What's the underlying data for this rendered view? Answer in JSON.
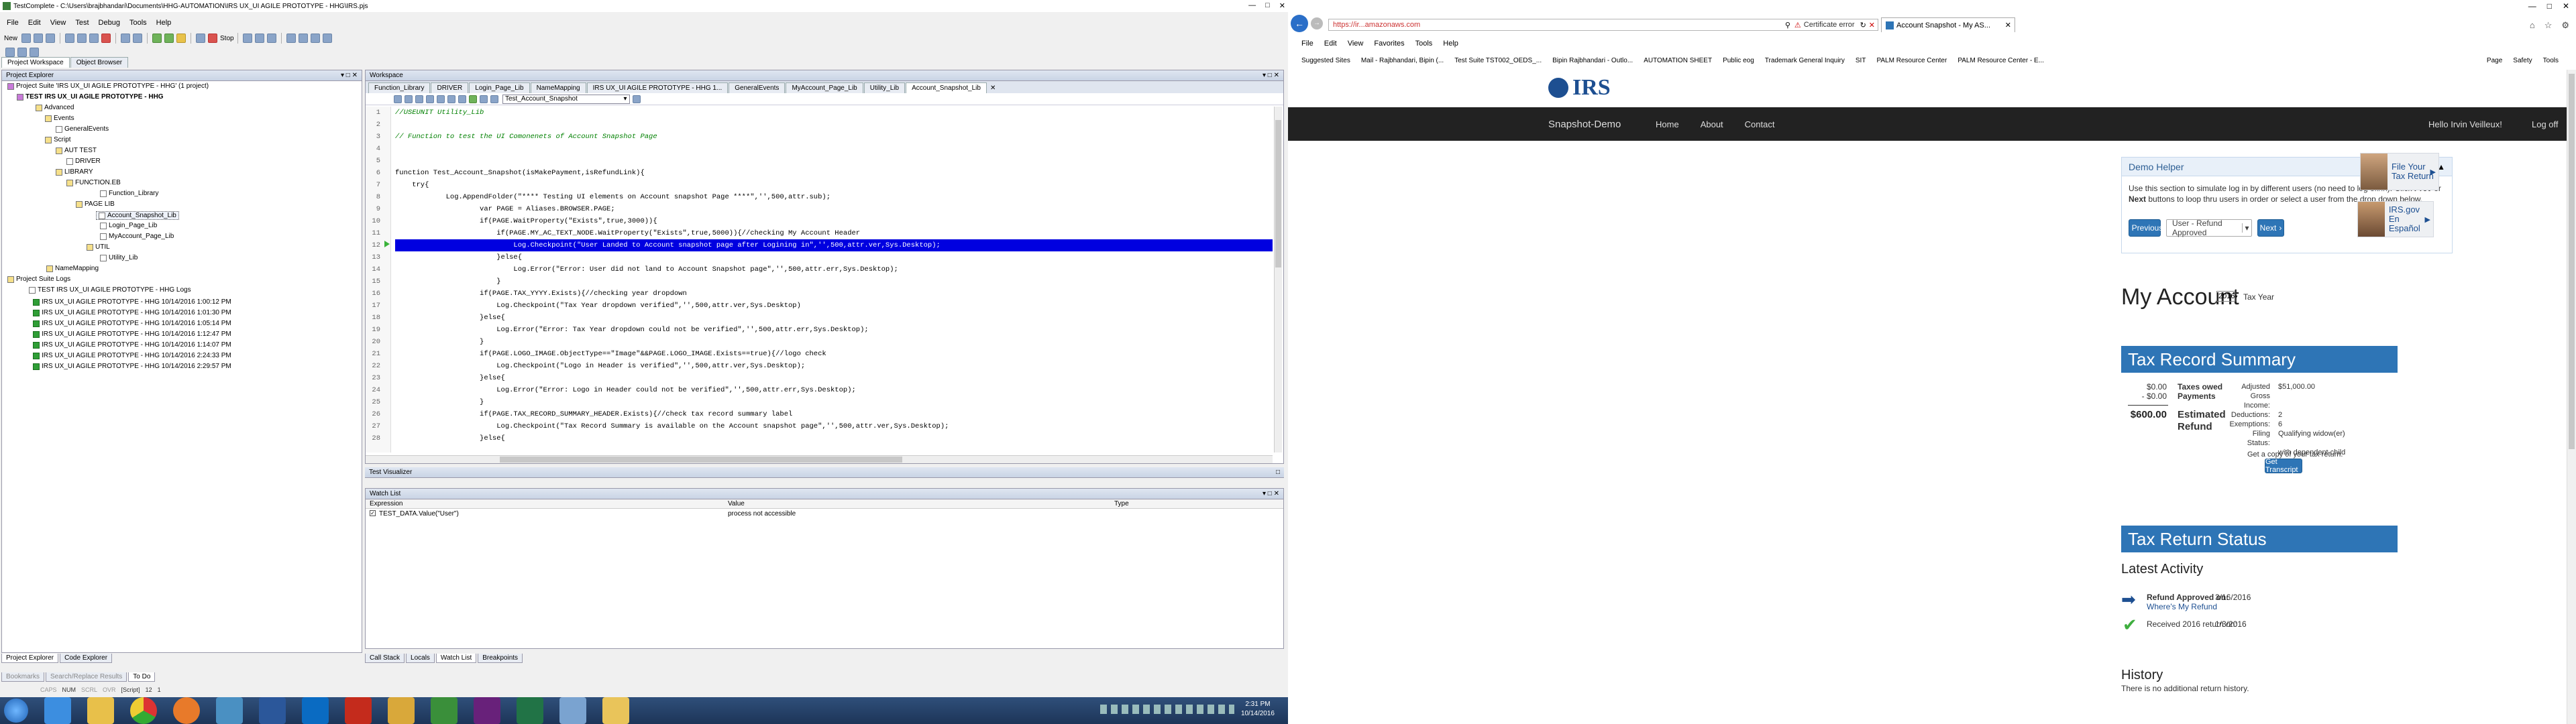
{
  "left": {
    "title": "TestComplete - C:\\Users\\brajbhandari\\Documents\\HHG-AUTOMATION\\IRS UX_UI AGILE PROTOTYPE - HHG\\IRS.pjs",
    "menu": [
      "File",
      "Edit",
      "View",
      "Test",
      "Debug",
      "Tools",
      "Help"
    ],
    "toolbar2": {
      "new": "New",
      "stop": "Stop"
    },
    "left_tabs": [
      "Project Workspace",
      "Object Browser"
    ],
    "project_explorer": {
      "header": "Project Explorer",
      "items": [
        "Project Suite 'IRS UX_UI AGILE PROTOTYPE - HHG' (1 project)",
        "TEST IRS UX_UI AGILE PROTOTYPE - HHG",
        "Advanced",
        "Events",
        "GeneralEvents",
        "Script",
        "AUT TEST",
        "DRIVER",
        "LIBRARY",
        "FUNCTION.EB",
        "Function_Library",
        "PAGE LIB",
        "Account_Snapshot_Lib",
        "Login_Page_Lib",
        "MyAccount_Page_Lib",
        "UTIL",
        "Utility_Lib",
        "NameMapping",
        "Project Suite Logs",
        "TEST IRS UX_UI AGILE PROTOTYPE - HHG Logs",
        "IRS UX_UI AGILE PROTOTYPE - HHG 10/14/2016 1:00:12 PM",
        "IRS UX_UI AGILE PROTOTYPE - HHG 10/14/2016 1:01:30 PM",
        "IRS UX_UI AGILE PROTOTYPE - HHG 10/14/2016 1:05:14 PM",
        "IRS UX_UI AGILE PROTOTYPE - HHG 10/14/2016 1:12:47 PM",
        "IRS UX_UI AGILE PROTOTYPE - HHG 10/14/2016 1:14:07 PM",
        "IRS UX_UI AGILE PROTOTYPE - HHG 10/14/2016 2:24:33 PM",
        "IRS UX_UI AGILE PROTOTYPE - HHG 10/14/2016 2:29:57 PM"
      ]
    },
    "bottom_left_tabs": [
      "Project Explorer",
      "Code Explorer"
    ],
    "bottom_left_tabs2": [
      "Bookmarks",
      "Search/Replace Results",
      "To Do"
    ],
    "workspace": {
      "header": "Workspace",
      "tabs": [
        "Function_Library",
        "DRIVER",
        "Login_Page_Lib",
        "NameMapping",
        "IRS UX_UI AGILE PROTOTYPE - HHG 1...",
        "GeneralEvents",
        "MyAccount_Page_Lib",
        "Utility_Lib",
        "Account_Snapshot_Lib"
      ],
      "routine": "Test_Account_Snapshot",
      "code": [
        "//USEUNIT Utility_Lib",
        "",
        "// Function to test the UI Comonenets of Account Snapshot Page",
        "",
        "",
        "function Test_Account_Snapshot(isMakePayment,isRefundLink){",
        "    try{",
        "            Log.AppendFolder(\"**** Testing UI elements on Account snapshot Page ****\",'',500,attr.sub);",
        "                    var PAGE = Aliases.BROWSER.PAGE;",
        "                    if(PAGE.WaitProperty(\"Exists\",true,3000)){",
        "                        if(PAGE.MY_AC_TEXT_NODE.WaitProperty(\"Exists\",true,5000)){//checking My Account Header",
        "                            Log.Checkpoint(\"User Landed to Account snapshot page after Logining in\",'',500,attr.ver,Sys.Desktop);",
        "                        }else{",
        "                            Log.Error(\"Error: User did not land to Account Snapshot page\",'',500,attr.err,Sys.Desktop);",
        "                        }",
        "                    if(PAGE.TAX_YYYY.Exists){//checking year dropdown",
        "                        Log.Checkpoint(\"Tax Year dropdown verified\",'',500,attr.ver,Sys.Desktop)",
        "                    }else{",
        "                        Log.Error(\"Error: Tax Year dropdown could not be verified\",'',500,attr.err,Sys.Desktop);",
        "                    }",
        "                    if(PAGE.LOGO_IMAGE.ObjectType==\"Image\"&&PAGE.LOGO_IMAGE.Exists==true){//logo check",
        "                        Log.Checkpoint(\"Logo in Header is verified\",'',500,attr.ver,Sys.Desktop);",
        "                    }else{",
        "                        Log.Error(\"Error: Logo in Header could not be verified\",'',500,attr.err,Sys.Desktop);",
        "                    }",
        "                    if(PAGE.TAX_RECORD_SUMMARY_HEADER.Exists){//check tax record summary label",
        "                        Log.Checkpoint(\"Tax Record Summary is available on the Account snapshot page\",'',500,attr.ver,Sys.Desktop);",
        "                    }else{"
      ]
    },
    "test_visualizer": "Test Visualizer",
    "watch": {
      "header": "Watch List",
      "columns": [
        "Expression",
        "Value",
        "Type"
      ],
      "row": {
        "expression": "TEST_DATA.Value(\"User\")",
        "value": "process not accessible",
        "type": ""
      }
    },
    "bottom_tabs": [
      "Call Stack",
      "Locals",
      "Watch List",
      "Breakpoints"
    ],
    "status": {
      "caps": "CAPS",
      "num": "NUM",
      "scrl": "SCRL",
      "ovr": "OVR",
      "script": "[Script]",
      "line": "12",
      "col": "1"
    }
  },
  "taskbar": {
    "icons": [
      "start-icon",
      "ie-icon",
      "folder-icon",
      "chrome-icon",
      "firefox-icon",
      "network-icon",
      "word-icon",
      "outlook-icon",
      "acrobat-icon",
      "explorer-icon",
      "testcomplete-icon",
      "vs-icon",
      "excel-icon",
      "snipping-icon",
      "notes-icon"
    ],
    "time": "2:31 PM",
    "date": "10/14/2016"
  },
  "browser": {
    "address": "https://ir...amazonaws.com",
    "cert": "Certificate error",
    "tab_title": "Account Snapshot - My AS...",
    "menu": [
      "File",
      "Edit",
      "View",
      "Favorites",
      "Tools",
      "Help"
    ],
    "favorites": [
      "Suggested Sites",
      "Mail - Rajbhandari, Bipin (...",
      "Test Suite TST002_OEDS_...",
      "Bipin Rajbhandari - Outlo...",
      "AUTOMATION SHEET",
      "Public eog",
      "Trademark General Inquiry",
      "SIT",
      "PALM Resource Center",
      "PALM Resource Center - E..."
    ],
    "cmd": [
      "Page",
      "Safety",
      "Tools"
    ]
  },
  "irs": {
    "logo": "IRS",
    "nav": {
      "brand": "Snapshot-Demo",
      "links": [
        "Home",
        "About",
        "Contact"
      ],
      "hello": "Hello Irvin Veilleux!",
      "logoff": "Log off"
    },
    "demo": {
      "title": "Demo Helper",
      "text_pre": "Use this section to simulate log in by different users (no need to log off/in). Click ",
      "prev_bold": "Prev",
      "text_mid": " or ",
      "next_bold": "Next",
      "text_post": " buttons to loop thru users in order or select a user from the drop down below.",
      "previous_btn": "Previous",
      "select_value": "User - Refund Approved",
      "next_btn": "Next"
    },
    "promo1": {
      "line1": "File Your",
      "line2": "Tax Return"
    },
    "promo2": {
      "line1": "IRS.gov",
      "line2": "En Español"
    },
    "my_account": "My Account",
    "year": "2016",
    "tax_year_label": "Tax Year",
    "summary": {
      "header": "Tax Record Summary",
      "taxes_owed_amt": "$0.00",
      "taxes_owed_label": "Taxes owed",
      "payments_amt": "- $0.00",
      "payments_label": "Payments",
      "refund_amt": "$600.00",
      "refund_label_1": "Estimated",
      "refund_label_2": "Refund",
      "agi_label": "Adjusted Gross",
      "agi_value": "$51,000.00",
      "income_label": "Income:",
      "deductions_label": "Deductions:",
      "deductions_value": "2",
      "exemptions_label": "Exemptions:",
      "exemptions_value": "6",
      "filing_label": "Filing Status:",
      "filing_value_1": "Qualifying widow(er)",
      "filing_value_2": "with dependent child",
      "transcript_text": "Get a copy of your tax return.",
      "transcript_btn": "Get Transcript"
    },
    "status": {
      "header": "Tax Return Status",
      "latest": "Latest Activity",
      "refund_approved": "Refund Approved on:",
      "refund_date": "3/16/2016",
      "wmr_link": "Where's My Refund",
      "received": "Received 2016 return on:",
      "received_date": "1/3/2016",
      "history": "History",
      "history_text": "There is no additional return history."
    }
  },
  "colors": {
    "irs_blue": "#2e75b6",
    "nav_dark": "#222222",
    "highlight": "#0000e0"
  }
}
